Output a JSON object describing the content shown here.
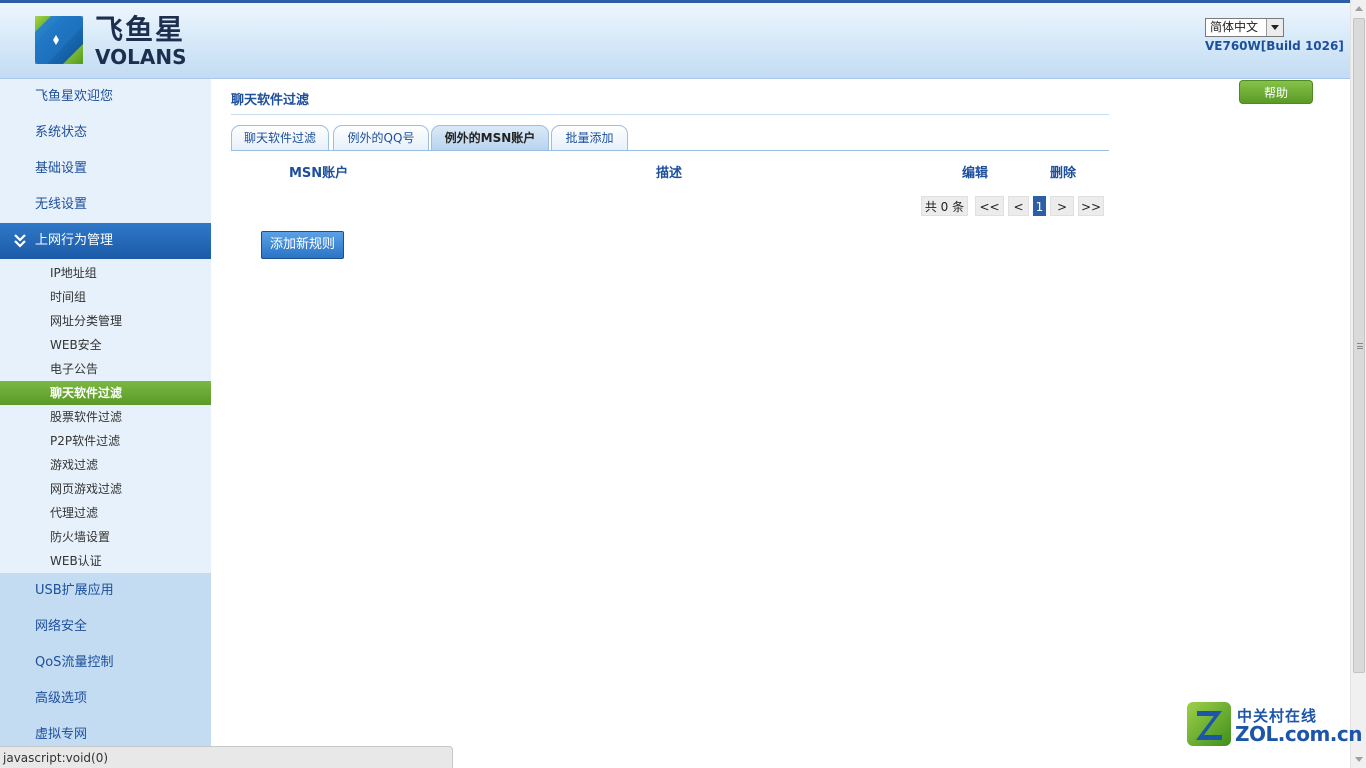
{
  "header": {
    "logo_cn": "飞鱼星",
    "logo_en": "VOLANS",
    "language": "简体中文",
    "version": "VE760W[Build 1026]"
  },
  "sidebar": {
    "top_items": [
      {
        "label": "飞鱼星欢迎您"
      },
      {
        "label": "系统状态"
      },
      {
        "label": "基础设置"
      },
      {
        "label": "无线设置"
      }
    ],
    "active_section": {
      "label": "上网行为管理",
      "icon": "double-chevron-down-icon"
    },
    "sub_items": [
      {
        "label": "IP地址组"
      },
      {
        "label": "时间组"
      },
      {
        "label": "网址分类管理"
      },
      {
        "label": "WEB安全"
      },
      {
        "label": "电子公告"
      },
      {
        "label": "聊天软件过滤",
        "active": true
      },
      {
        "label": "股票软件过滤"
      },
      {
        "label": "P2P软件过滤"
      },
      {
        "label": "游戏过滤"
      },
      {
        "label": "网页游戏过滤"
      },
      {
        "label": "代理过滤"
      },
      {
        "label": "防火墙设置"
      },
      {
        "label": "WEB认证"
      }
    ],
    "bottom_items": [
      {
        "label": "USB扩展应用"
      },
      {
        "label": "网络安全"
      },
      {
        "label": "QoS流量控制"
      },
      {
        "label": "高级选项"
      },
      {
        "label": "虚拟专网"
      }
    ]
  },
  "main": {
    "title": "聊天软件过滤",
    "help_label": "帮助",
    "tabs": [
      {
        "label": "聊天软件过滤"
      },
      {
        "label": "例外的QQ号"
      },
      {
        "label": "例外的MSN账户",
        "active": true
      },
      {
        "label": "批量添加"
      }
    ],
    "table": {
      "headers": {
        "account": "MSN账户",
        "description": "描述",
        "edit": "编辑",
        "delete": "删除"
      },
      "rows": []
    },
    "pager": {
      "total": "共 0 条",
      "first": "<<",
      "prev": "<",
      "current": "1",
      "next": ">",
      "last": ">>"
    },
    "add_button": "添加新规则"
  },
  "statusbar": {
    "text": "javascript:void(0)"
  },
  "watermark": {
    "cn": "中关村在线",
    "en": "ZOL.com.cn"
  },
  "colors": {
    "brand_blue": "#1d4f9c",
    "active_green": "#5c9a28",
    "header_border": "#2d5fa6"
  }
}
